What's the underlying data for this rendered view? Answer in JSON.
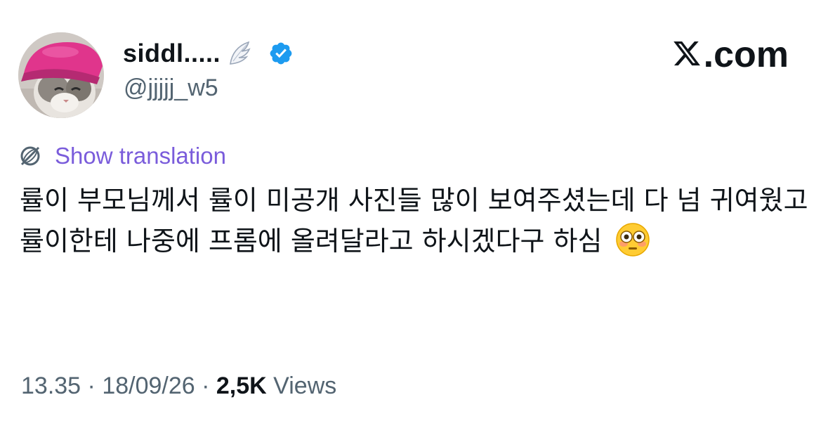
{
  "author": {
    "display_name": "siddl.....",
    "handle": "@jjjjj_w5",
    "avatar_icon": "cat-with-pink-hat-avatar",
    "badge_emoji_icon": "wing-icon",
    "verified_icon": "verified-badge-icon",
    "verified_color": "#1d9bf0"
  },
  "brand": {
    "logo_text": ".com",
    "logo_icon": "x-logo-icon"
  },
  "translation": {
    "label": "Show translation",
    "icon": "globe-icon",
    "color": "#7a5cdb"
  },
  "tweet": {
    "text": "률이 부모님께서 률이 미공개 사진들 많이 보여주셨는데 다 넘 귀여웠고 률이한테 나중에 프롬에 올려달라고 하시겠다구 하심",
    "emoji_icon": "flushed-face-icon"
  },
  "meta": {
    "time": "13.35",
    "sep1": " · ",
    "date": "18/09/26",
    "sep2": " · ",
    "views_count": "2,5K",
    "views_label": " Views"
  }
}
